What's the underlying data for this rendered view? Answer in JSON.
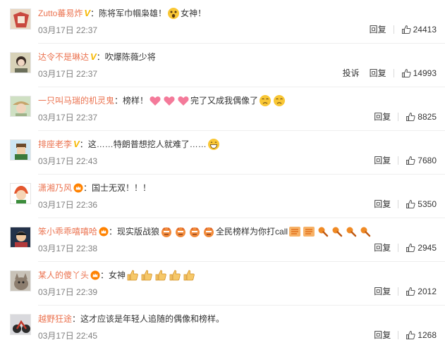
{
  "comments": [
    {
      "user": "Zutto蕃易炸",
      "badge": "V",
      "colon": "：",
      "text1": "陈将军巾帼枭雄！",
      "text2": "女神！",
      "time": "03月17日 22:37",
      "report": "",
      "reply": "回复",
      "likes": "24413"
    },
    {
      "user": "达令不是琳达",
      "badge": "V",
      "colon": "：",
      "text1": "吹爆陈薇少将",
      "time": "03月17日 22:37",
      "report": "投诉",
      "reply": "回复",
      "likes": "14993"
    },
    {
      "user": "一只叫马瑞的机灵鬼",
      "colon": "：",
      "text1": "榜样！",
      "text2": "完了又成我偶像了",
      "time": "03月17日 22:37",
      "reply": "回复",
      "likes": "8825"
    },
    {
      "user": "排座老李",
      "badge": "V",
      "colon": "：",
      "text1": "这……特朗普想挖人就难了……",
      "time": "03月17日 22:43",
      "reply": "回复",
      "likes": "7680"
    },
    {
      "user": "潇湘乃风",
      "colon": "：",
      "text1": "国士无双！！！",
      "time": "03月17日 22:36",
      "reply": "回复",
      "likes": "5350"
    },
    {
      "user": "笨小乖乖嘻嘻哈",
      "colon": "：",
      "text1": "现实版战狼",
      "text2": "全民榜样为你打call",
      "time": "03月17日 22:38",
      "reply": "回复",
      "likes": "2945"
    },
    {
      "user": "某人的傻丫头",
      "colon": "：",
      "text1": "女神",
      "time": "03月17日 22:39",
      "reply": "回复",
      "likes": "2012"
    },
    {
      "user": "越野狂途",
      "colon": "：",
      "text1": "这才应该是年轻人追随的偶像和榜样。",
      "time": "03月17日 22:45",
      "reply": "回复",
      "likes": "1268"
    }
  ],
  "colors": {
    "username": "#eb7350",
    "vbadge": "#f6b700",
    "time": "#808080"
  },
  "icons": {
    "like": "thumbs-up-outline-icon",
    "v": "verified-v-icon",
    "crown": "member-crown-icon"
  }
}
